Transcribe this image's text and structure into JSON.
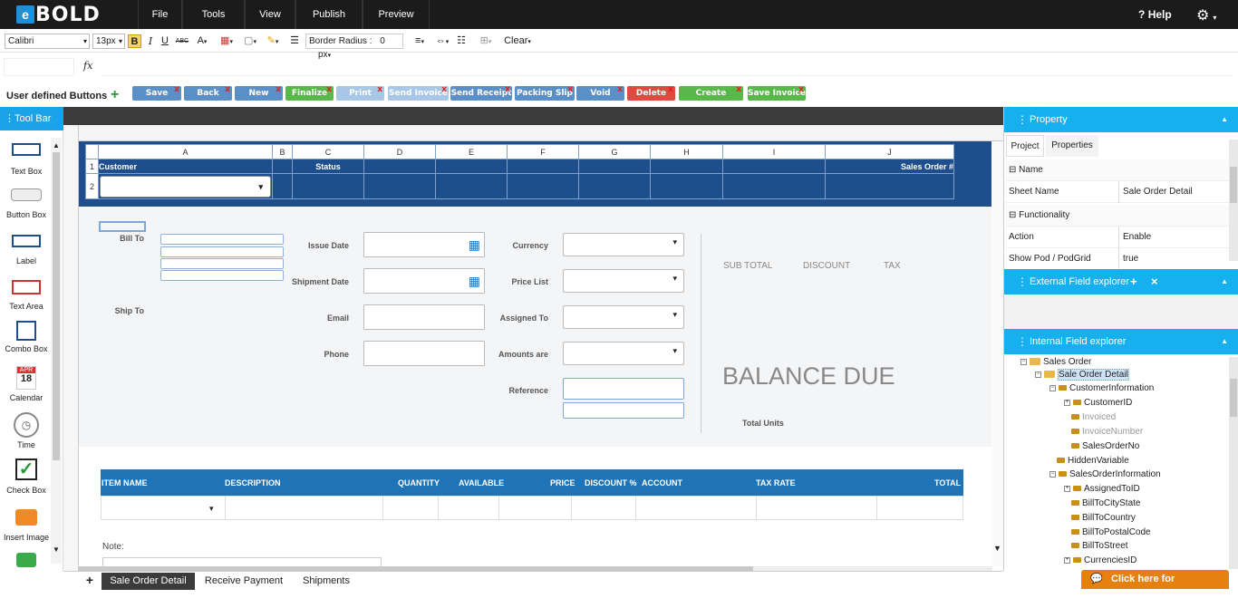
{
  "app": {
    "logo_e": "e",
    "logo_text": "BOLD"
  },
  "menu": [
    "File",
    "Tools",
    "View",
    "Publish",
    "Preview"
  ],
  "help": "Help",
  "format": {
    "font": "Calibri",
    "size": "13px",
    "bold": "B",
    "italic": "I",
    "underline": "U",
    "strike": "ABC",
    "border_radius_label": "Border Radius :",
    "border_radius_value": "0",
    "border_radius_unit": "px",
    "clear": "Clear"
  },
  "formula": {
    "fx": "fx"
  },
  "user_buttons": {
    "label": "User defined Buttons",
    "add": "+",
    "buttons": [
      {
        "label": "Save",
        "color": "#5b8fc7"
      },
      {
        "label": "Back",
        "color": "#5b8fc7"
      },
      {
        "label": "New",
        "color": "#5b8fc7"
      },
      {
        "label": "Finalize",
        "color": "#59b84a"
      },
      {
        "label": "Print",
        "color": "#a8c7e6"
      },
      {
        "label": "Send Invoice",
        "color": "#a8c7e6"
      },
      {
        "label": "Send Receipt",
        "color": "#5b8fc7"
      },
      {
        "label": "Packing Slip",
        "color": "#5b8fc7"
      },
      {
        "label": "Void",
        "color": "#5b8fc7"
      },
      {
        "label": "Delete",
        "color": "#de4b3e"
      },
      {
        "label": "Create Invoice",
        "color": "#59b84a"
      },
      {
        "label": "Save Invoice",
        "color": "#59b84a"
      }
    ]
  },
  "toolbar": {
    "title": "Tool Bar",
    "tools": [
      "Text Box",
      "Button Box",
      "Label",
      "Text Area",
      "Combo Box",
      "Calendar",
      "Time",
      "Check Box",
      "Insert Image"
    ],
    "calendar_month": "APR",
    "calendar_day": "18"
  },
  "sheet": {
    "columns": [
      "A",
      "B",
      "C",
      "D",
      "E",
      "F",
      "G",
      "H",
      "I",
      "J"
    ],
    "rows": [
      "1",
      "2"
    ],
    "row1": {
      "A": "Customer",
      "C": "Status",
      "J": "Sales Order #"
    }
  },
  "form": {
    "bill_to": "Bill To",
    "ship_to": "Ship To",
    "issue_date": "Issue Date",
    "shipment_date": "Shipment Date",
    "email": "Email",
    "phone": "Phone",
    "currency": "Currency",
    "price_list": "Price List",
    "assigned_to": "Assigned To",
    "amounts_are": "Amounts are",
    "reference": "Reference",
    "sub_total": "SUB TOTAL",
    "discount": "DISCOUNT",
    "tax": "TAX",
    "balance_due": "BALANCE DUE",
    "total_units": "Total Units"
  },
  "items": {
    "headers": [
      "ITEM NAME",
      "DESCRIPTION",
      "QUANTITY",
      "AVAILABLE",
      "PRICE",
      "DISCOUNT %",
      "ACCOUNT",
      "TAX RATE",
      "TOTAL"
    ],
    "note": "Note:"
  },
  "property": {
    "title": "Property",
    "tabs": [
      "Project",
      "Properties"
    ],
    "name_section": "Name",
    "functionality_section": "Functionality",
    "rows": [
      {
        "key": "Sheet Name",
        "value": "Sale Order Detail"
      },
      {
        "key": "Action",
        "value": "Enable"
      },
      {
        "key": "Show Pod / PodGrid",
        "value": "true"
      }
    ]
  },
  "external_explorer": {
    "title": "External Field explorer",
    "add": "+",
    "close": "×"
  },
  "internal_explorer": {
    "title": "Internal Field explorer",
    "nodes": [
      {
        "label": "Sales Order"
      },
      {
        "label": "Sale Order Detail"
      },
      {
        "label": "CustomerInformation"
      },
      {
        "label": "CustomerID"
      },
      {
        "label": "Invoiced"
      },
      {
        "label": "InvoiceNumber"
      },
      {
        "label": "SalesOrderNo"
      },
      {
        "label": "HiddenVariable"
      },
      {
        "label": "SalesOrderInformation"
      },
      {
        "label": "AssignedToID"
      },
      {
        "label": "BillToCityState"
      },
      {
        "label": "BillToCountry"
      },
      {
        "label": "BillToPostalCode"
      },
      {
        "label": "BillToStreet"
      },
      {
        "label": "CurrenciesID"
      }
    ]
  },
  "sheet_tabs": [
    "Sale Order Detail",
    "Receive Payment",
    "Shipments"
  ],
  "sheet_tab_add": "+",
  "assistance": "Click here for Assistance"
}
